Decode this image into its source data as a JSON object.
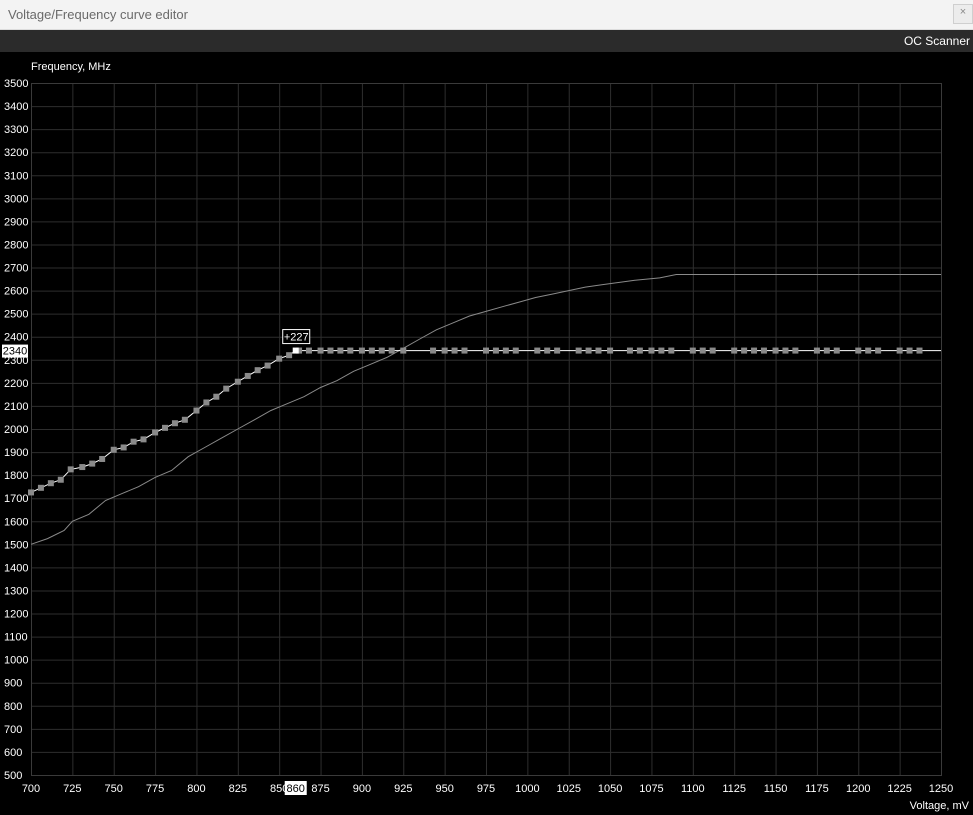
{
  "window": {
    "title": "Voltage/Frequency curve editor",
    "close_glyph": "×"
  },
  "toolbar": {
    "oc_scanner_label": "OC Scanner"
  },
  "colors": {
    "background": "#000000",
    "grid": "#2e2e2e",
    "curve": "#ffffff",
    "reference_curve": "#8a8a8a",
    "point": "#8a8a8a",
    "selected_point": "#ffffff"
  },
  "chart_data": {
    "type": "line",
    "xlabel": "Voltage, mV",
    "ylabel": "Frequency, MHz",
    "xlim": [
      700,
      1250
    ],
    "ylim": [
      500,
      3500
    ],
    "x_ticks": [
      700,
      725,
      750,
      775,
      800,
      825,
      850,
      875,
      900,
      925,
      950,
      975,
      1000,
      1025,
      1050,
      1075,
      1100,
      1125,
      1150,
      1175,
      1200,
      1225,
      1250
    ],
    "y_ticks": [
      500,
      600,
      700,
      800,
      900,
      1000,
      1100,
      1200,
      1300,
      1400,
      1500,
      1600,
      1700,
      1800,
      1900,
      2000,
      2100,
      2200,
      2300,
      2400,
      2500,
      2600,
      2700,
      2800,
      2900,
      3000,
      3100,
      3200,
      3300,
      3400,
      3500
    ],
    "grid": true,
    "selected": {
      "voltage": 860,
      "frequency": 2340,
      "offset_label": "+227",
      "voltage_label": "860",
      "frequency_label": "2340"
    },
    "series": [
      {
        "role": "edited_curve",
        "points": [
          [
            700,
            1725
          ],
          [
            706,
            1745
          ],
          [
            712,
            1765
          ],
          [
            718,
            1780
          ],
          [
            724,
            1825
          ],
          [
            731,
            1835
          ],
          [
            737,
            1850
          ],
          [
            743,
            1870
          ],
          [
            750,
            1910
          ],
          [
            756,
            1920
          ],
          [
            762,
            1945
          ],
          [
            768,
            1955
          ],
          [
            775,
            1985
          ],
          [
            781,
            2005
          ],
          [
            787,
            2025
          ],
          [
            793,
            2040
          ],
          [
            800,
            2080
          ],
          [
            806,
            2115
          ],
          [
            812,
            2140
          ],
          [
            818,
            2175
          ],
          [
            825,
            2205
          ],
          [
            831,
            2230
          ],
          [
            837,
            2255
          ],
          [
            843,
            2275
          ],
          [
            850,
            2305
          ],
          [
            856,
            2320
          ],
          [
            860,
            2340
          ],
          [
            1250,
            2340
          ]
        ],
        "marker_voltages": [
          700,
          706,
          712,
          718,
          724,
          731,
          737,
          743,
          750,
          756,
          762,
          768,
          775,
          781,
          787,
          793,
          800,
          806,
          812,
          818,
          825,
          831,
          837,
          843,
          850,
          856,
          862,
          868,
          875,
          881,
          887,
          893,
          900,
          906,
          912,
          918,
          925,
          943,
          950,
          956,
          962,
          975,
          981,
          987,
          993,
          1006,
          1012,
          1018,
          1031,
          1037,
          1043,
          1050,
          1062,
          1068,
          1075,
          1081,
          1087,
          1100,
          1106,
          1112,
          1125,
          1131,
          1137,
          1143,
          1150,
          1156,
          1162,
          1175,
          1181,
          1187,
          1200,
          1206,
          1212,
          1225,
          1231,
          1237
        ]
      },
      {
        "role": "default_curve",
        "points": [
          [
            700,
            1500
          ],
          [
            710,
            1525
          ],
          [
            720,
            1560
          ],
          [
            725,
            1600
          ],
          [
            735,
            1630
          ],
          [
            745,
            1690
          ],
          [
            755,
            1720
          ],
          [
            765,
            1750
          ],
          [
            775,
            1790
          ],
          [
            785,
            1820
          ],
          [
            795,
            1880
          ],
          [
            805,
            1920
          ],
          [
            815,
            1960
          ],
          [
            825,
            2000
          ],
          [
            835,
            2040
          ],
          [
            845,
            2080
          ],
          [
            855,
            2110
          ],
          [
            865,
            2140
          ],
          [
            875,
            2180
          ],
          [
            885,
            2210
          ],
          [
            895,
            2250
          ],
          [
            905,
            2280
          ],
          [
            915,
            2310
          ],
          [
            925,
            2350
          ],
          [
            935,
            2390
          ],
          [
            945,
            2430
          ],
          [
            955,
            2460
          ],
          [
            965,
            2490
          ],
          [
            975,
            2510
          ],
          [
            985,
            2530
          ],
          [
            995,
            2550
          ],
          [
            1005,
            2570
          ],
          [
            1015,
            2585
          ],
          [
            1025,
            2600
          ],
          [
            1035,
            2615
          ],
          [
            1045,
            2625
          ],
          [
            1055,
            2635
          ],
          [
            1065,
            2645
          ],
          [
            1080,
            2655
          ],
          [
            1090,
            2670
          ],
          [
            1250,
            2670
          ]
        ]
      }
    ]
  }
}
